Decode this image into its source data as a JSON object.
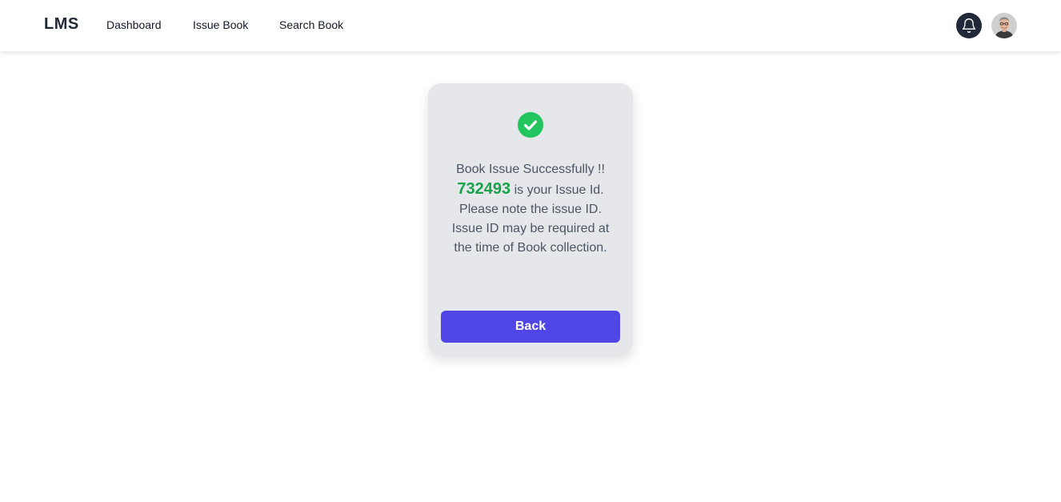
{
  "navbar": {
    "brand": "LMS",
    "links": [
      {
        "label": "Dashboard"
      },
      {
        "label": "Issue Book"
      },
      {
        "label": "Search Book"
      }
    ],
    "notification_icon": "bell-icon",
    "avatar_icon": "user-avatar"
  },
  "result_card": {
    "status_icon": "check-circle-icon",
    "message_prefix": "Book Issue Successfully !! ",
    "issue_id": "732493",
    "message_suffix": " is your Issue Id. Please note the issue ID. Issue ID may be required at the time of Book collection.",
    "back_label": "Back"
  },
  "colors": {
    "primary": "#4f46e5",
    "success": "#22c55e",
    "issue_id": "#16a34a",
    "card_bg": "#e5e7eb",
    "dark": "#1f2937"
  }
}
